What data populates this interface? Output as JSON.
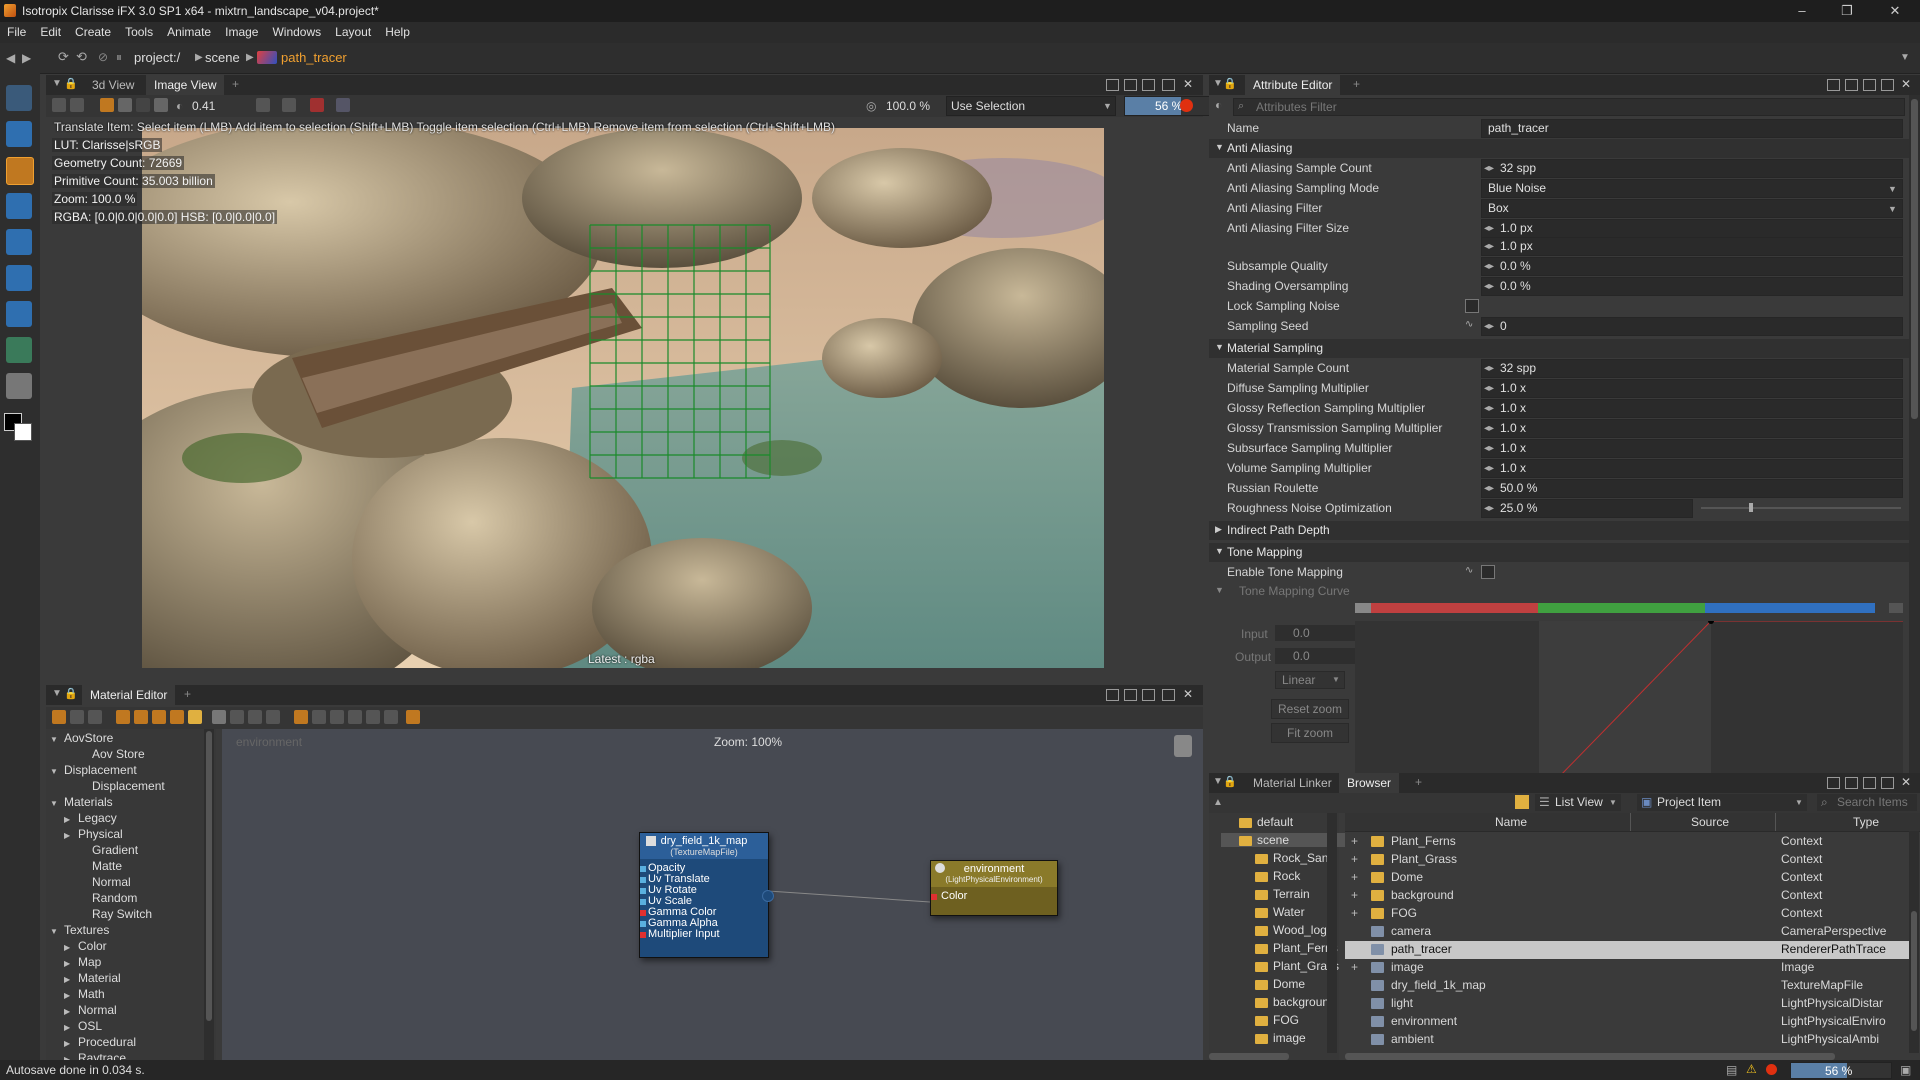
{
  "window": {
    "title": "Isotropix Clarisse iFX 3.0 SP1 x64  - mixtrn_landscape_v04.project*"
  },
  "menu": [
    "File",
    "Edit",
    "Create",
    "Tools",
    "Animate",
    "Image",
    "Windows",
    "Layout",
    "Help"
  ],
  "breadcrumb": {
    "project": "project:/",
    "scene": "scene",
    "item": "path_tracer"
  },
  "viewport": {
    "tabs": [
      "3d View",
      "Image View"
    ],
    "exposure": "0.41",
    "zoom": "100.0 %",
    "selection_mode": "Use Selection",
    "progress": "56 %",
    "progress_value": 56,
    "hint": "Translate Item: Select item (LMB)  Add item to selection (Shift+LMB)  Toggle item selection (Ctrl+LMB)  Remove item from selection (Ctrl+Shift+LMB)",
    "info": {
      "lut": "LUT: Clarisse|sRGB",
      "geometry": "Geometry Count: 72669",
      "primitive": "Primitive Count: 35.003 billion",
      "zoom": "Zoom: 100.0 %",
      "rgba": "RGBA: [0.0|0.0|0.0|0.0] HSB: [0.0|0.0|0.0]"
    },
    "footer": "Latest : rgba"
  },
  "attribute_editor": {
    "tab": "Attribute Editor",
    "filter_placeholder": "Attributes Filter",
    "name_label": "Name",
    "name_value": "path_tracer",
    "sections": {
      "anti_aliasing": "Anti Aliasing",
      "material_sampling": "Material Sampling",
      "indirect": "Indirect Path Depth",
      "tone_mapping": "Tone Mapping"
    },
    "rows": {
      "aa_sample_count": {
        "label": "Anti Aliasing Sample Count",
        "value": "32 spp"
      },
      "aa_sampling_mode": {
        "label": "Anti Aliasing Sampling Mode",
        "value": "Blue Noise"
      },
      "aa_filter": {
        "label": "Anti Aliasing Filter",
        "value": "Box"
      },
      "aa_filter_size": {
        "label": "Anti Aliasing Filter Size",
        "value": "1.0 px",
        "value2": "1.0 px"
      },
      "subsample_quality": {
        "label": "Subsample Quality",
        "value": "0.0 %"
      },
      "shading_oversampling": {
        "label": "Shading Oversampling",
        "value": "0.0 %"
      },
      "lock_sampling_noise": {
        "label": "Lock Sampling Noise"
      },
      "sampling_seed": {
        "label": "Sampling Seed",
        "value": "0"
      },
      "material_sample_count": {
        "label": "Material Sample Count",
        "value": "32 spp"
      },
      "diffuse_mult": {
        "label": "Diffuse Sampling Multiplier",
        "value": "1.0 x"
      },
      "glossy_refl_mult": {
        "label": "Glossy Reflection Sampling Multiplier",
        "value": "1.0 x"
      },
      "glossy_trans_mult": {
        "label": "Glossy Transmission Sampling Multiplier",
        "value": "1.0 x"
      },
      "subsurface_mult": {
        "label": "Subsurface Sampling Multiplier",
        "value": "1.0 x"
      },
      "volume_mult": {
        "label": "Volume Sampling Multiplier",
        "value": "1.0 x"
      },
      "russian_roulette": {
        "label": "Russian Roulette",
        "value": "50.0 %"
      },
      "roughness_noise": {
        "label": "Roughness Noise Optimization",
        "value": "25.0 %"
      },
      "enable_tone_mapping": {
        "label": "Enable Tone Mapping"
      }
    },
    "tone_curve": {
      "label": "Tone Mapping Curve",
      "input_label": "Input",
      "input_value": "0.0",
      "output_label": "Output",
      "output_value": "0.0",
      "interp": "Linear",
      "reset_zoom": "Reset zoom",
      "fit_zoom": "Fit zoom"
    }
  },
  "material_editor": {
    "tab": "Material Editor",
    "context": "environment",
    "zoom": "Zoom: 100%",
    "tree": [
      {
        "label": "AovStore",
        "level": 0,
        "arrow": "▼"
      },
      {
        "label": "Aov Store",
        "level": 2,
        "arrow": ""
      },
      {
        "label": "Displacement",
        "level": 0,
        "arrow": "▼"
      },
      {
        "label": "Displacement",
        "level": 2,
        "arrow": ""
      },
      {
        "label": "Materials",
        "level": 0,
        "arrow": "▼"
      },
      {
        "label": "Legacy",
        "level": 1,
        "arrow": "▶"
      },
      {
        "label": "Physical",
        "level": 1,
        "arrow": "▶"
      },
      {
        "label": "Gradient",
        "level": 2,
        "arrow": ""
      },
      {
        "label": "Matte",
        "level": 2,
        "arrow": ""
      },
      {
        "label": "Normal",
        "level": 2,
        "arrow": ""
      },
      {
        "label": "Random",
        "level": 2,
        "arrow": ""
      },
      {
        "label": "Ray Switch",
        "level": 2,
        "arrow": ""
      },
      {
        "label": "Textures",
        "level": 0,
        "arrow": "▼"
      },
      {
        "label": "Color",
        "level": 1,
        "arrow": "▶"
      },
      {
        "label": "Map",
        "level": 1,
        "arrow": "▶"
      },
      {
        "label": "Material",
        "level": 1,
        "arrow": "▶"
      },
      {
        "label": "Math",
        "level": 1,
        "arrow": "▶"
      },
      {
        "label": "Normal",
        "level": 1,
        "arrow": "▶"
      },
      {
        "label": "OSL",
        "level": 1,
        "arrow": "▶"
      },
      {
        "label": "Procedural",
        "level": 1,
        "arrow": "▶"
      },
      {
        "label": "Raytrace",
        "level": 1,
        "arrow": "▶"
      }
    ],
    "node_texture": {
      "title": "dry_field_1k_map",
      "subtitle": "(TextureMapFile)",
      "ports": [
        "Opacity",
        "Uv Translate",
        "Uv Rotate",
        "Uv Scale",
        "Gamma Color",
        "Gamma Alpha",
        "Multiplier Input"
      ]
    },
    "node_env": {
      "title": "environment",
      "subtitle": "(LightPhysicalEnvironment)",
      "port": "Color"
    }
  },
  "browser": {
    "tabs": [
      "Material Linker",
      "Browser"
    ],
    "view_mode": "List View",
    "filter": "Project Item",
    "search_placeholder": "Search Items",
    "columns": [
      "Name",
      "Source",
      "Type"
    ],
    "tree": [
      "default",
      "scene",
      "Rock_Sand",
      "Rock",
      "Terrain",
      "Water",
      "Wood_log",
      "Plant_Ferns",
      "Plant_Grass",
      "Dome",
      "background",
      "FOG",
      "image"
    ],
    "rows": [
      {
        "name": "Plant_Ferns",
        "source": "",
        "type": "Context"
      },
      {
        "name": "Plant_Grass",
        "source": "",
        "type": "Context"
      },
      {
        "name": "Dome",
        "source": "",
        "type": "Context"
      },
      {
        "name": "background",
        "source": "",
        "type": "Context"
      },
      {
        "name": "FOG",
        "source": "",
        "type": "Context"
      },
      {
        "name": "camera",
        "source": "",
        "type": "CameraPerspective"
      },
      {
        "name": "path_tracer",
        "source": "",
        "type": "RendererPathTrace"
      },
      {
        "name": "image",
        "source": "",
        "type": "Image"
      },
      {
        "name": "dry_field_1k_map",
        "source": "",
        "type": "TextureMapFile"
      },
      {
        "name": "light",
        "source": "",
        "type": "LightPhysicalDistar"
      },
      {
        "name": "environment",
        "source": "",
        "type": "LightPhysicalEnviro"
      },
      {
        "name": "ambient",
        "source": "",
        "type": "LightPhysicalAmbi"
      }
    ]
  },
  "status": {
    "message": "Autosave done in 0.034 s.",
    "progress": "56 %",
    "progress_value": 56
  },
  "colors": {
    "accent": "#f0a030",
    "selection": "#c8c8c8",
    "texture_node": "#1e4a7a",
    "env_node": "#6e6020"
  }
}
